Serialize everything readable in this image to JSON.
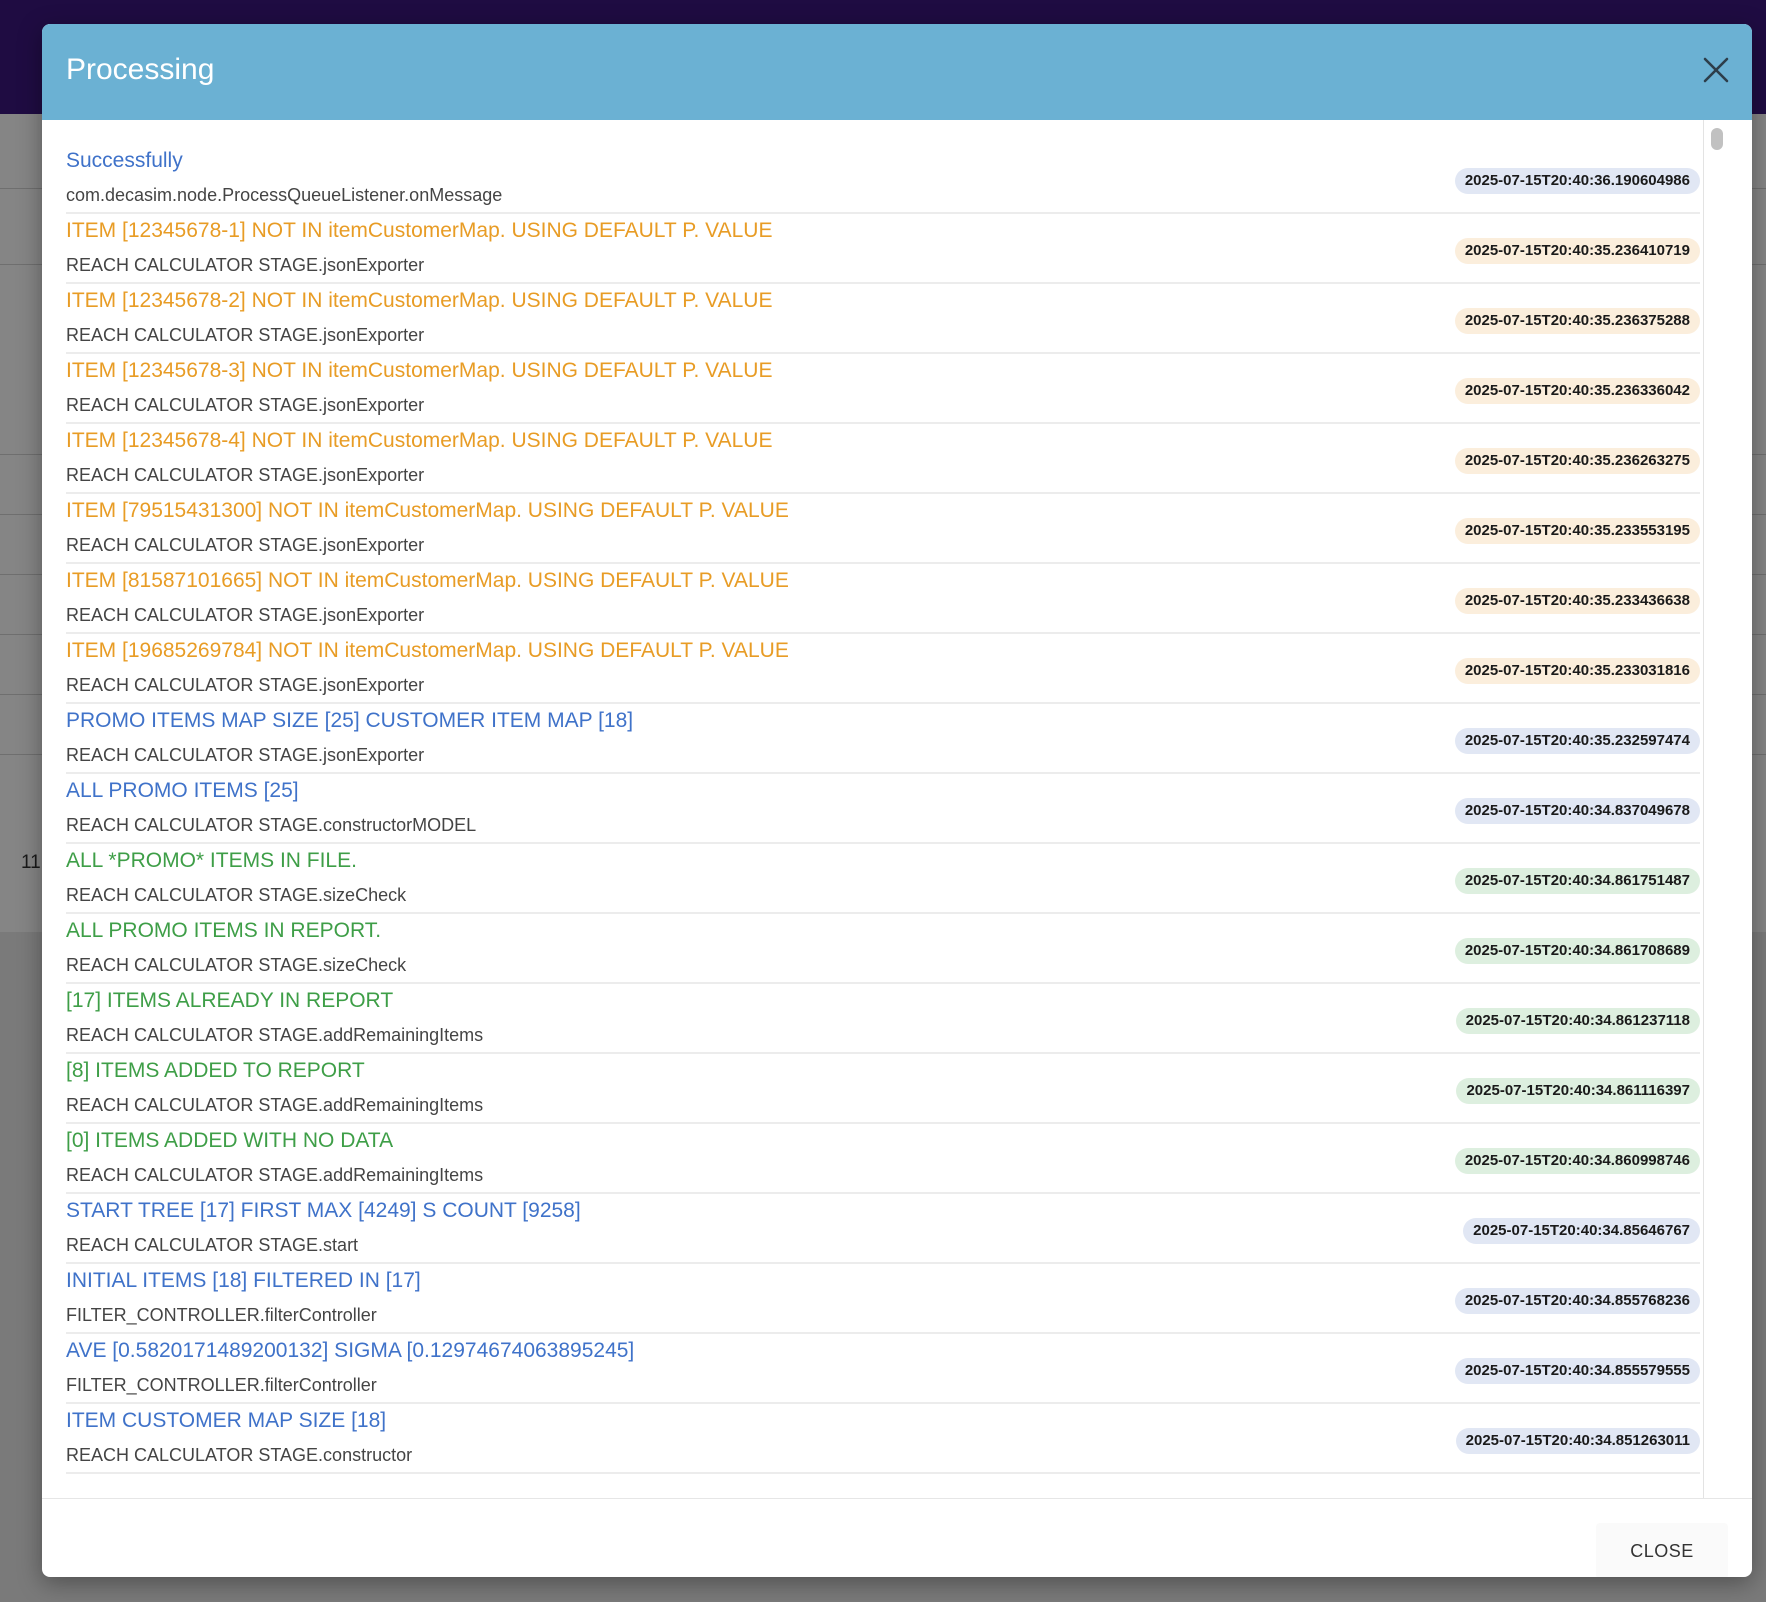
{
  "modal": {
    "title": "Processing",
    "close_label": "CLOSE"
  },
  "background": {
    "stub_text": "11"
  },
  "colors": {
    "header_bg": "#6bb1d3",
    "info": "#3f72c9",
    "warning": "#e89c25",
    "success": "#3e9e47",
    "badge_info": "#e1e7f4",
    "badge_warning": "#fbeedc",
    "badge_success": "#ddefdf"
  },
  "logs": [
    {
      "message": "Successfully",
      "source": "com.decasim.node.ProcessQueueListener.onMessage",
      "timestamp": "2025-07-15T20:40:36.190604986",
      "level": "info"
    },
    {
      "message": "ITEM [12345678-1] NOT IN itemCustomerMap. USING DEFAULT P. VALUE",
      "source": "REACH CALCULATOR STAGE.jsonExporter",
      "timestamp": "2025-07-15T20:40:35.236410719",
      "level": "warning"
    },
    {
      "message": "ITEM [12345678-2] NOT IN itemCustomerMap. USING DEFAULT P. VALUE",
      "source": "REACH CALCULATOR STAGE.jsonExporter",
      "timestamp": "2025-07-15T20:40:35.236375288",
      "level": "warning"
    },
    {
      "message": "ITEM [12345678-3] NOT IN itemCustomerMap. USING DEFAULT P. VALUE",
      "source": "REACH CALCULATOR STAGE.jsonExporter",
      "timestamp": "2025-07-15T20:40:35.236336042",
      "level": "warning"
    },
    {
      "message": "ITEM [12345678-4] NOT IN itemCustomerMap. USING DEFAULT P. VALUE",
      "source": "REACH CALCULATOR STAGE.jsonExporter",
      "timestamp": "2025-07-15T20:40:35.236263275",
      "level": "warning"
    },
    {
      "message": "ITEM [79515431300] NOT IN itemCustomerMap. USING DEFAULT P. VALUE",
      "source": "REACH CALCULATOR STAGE.jsonExporter",
      "timestamp": "2025-07-15T20:40:35.233553195",
      "level": "warning"
    },
    {
      "message": "ITEM [81587101665] NOT IN itemCustomerMap. USING DEFAULT P. VALUE",
      "source": "REACH CALCULATOR STAGE.jsonExporter",
      "timestamp": "2025-07-15T20:40:35.233436638",
      "level": "warning"
    },
    {
      "message": "ITEM [19685269784] NOT IN itemCustomerMap. USING DEFAULT P. VALUE",
      "source": "REACH CALCULATOR STAGE.jsonExporter",
      "timestamp": "2025-07-15T20:40:35.233031816",
      "level": "warning"
    },
    {
      "message": "PROMO ITEMS MAP SIZE [25] CUSTOMER ITEM MAP [18]",
      "source": "REACH CALCULATOR STAGE.jsonExporter",
      "timestamp": "2025-07-15T20:40:35.232597474",
      "level": "info"
    },
    {
      "message": "ALL PROMO ITEMS [25]",
      "source": "REACH CALCULATOR STAGE.constructorMODEL",
      "timestamp": "2025-07-15T20:40:34.837049678",
      "level": "info"
    },
    {
      "message": "ALL *PROMO* ITEMS IN FILE.",
      "source": "REACH CALCULATOR STAGE.sizeCheck",
      "timestamp": "2025-07-15T20:40:34.861751487",
      "level": "success"
    },
    {
      "message": "ALL PROMO ITEMS IN REPORT.",
      "source": "REACH CALCULATOR STAGE.sizeCheck",
      "timestamp": "2025-07-15T20:40:34.861708689",
      "level": "success"
    },
    {
      "message": "[17] ITEMS ALREADY IN REPORT",
      "source": "REACH CALCULATOR STAGE.addRemainingItems",
      "timestamp": "2025-07-15T20:40:34.861237118",
      "level": "success"
    },
    {
      "message": "[8] ITEMS ADDED TO REPORT",
      "source": "REACH CALCULATOR STAGE.addRemainingItems",
      "timestamp": "2025-07-15T20:40:34.861116397",
      "level": "success"
    },
    {
      "message": "[0] ITEMS ADDED WITH NO DATA",
      "source": "REACH CALCULATOR STAGE.addRemainingItems",
      "timestamp": "2025-07-15T20:40:34.860998746",
      "level": "success"
    },
    {
      "message": "START TREE [17] FIRST MAX [4249] S COUNT [9258]",
      "source": "REACH CALCULATOR STAGE.start",
      "timestamp": "2025-07-15T20:40:34.85646767",
      "level": "info"
    },
    {
      "message": "INITIAL ITEMS [18] FILTERED IN [17]",
      "source": "FILTER_CONTROLLER.filterController",
      "timestamp": "2025-07-15T20:40:34.855768236",
      "level": "info"
    },
    {
      "message": "AVE [0.5820171489200132] SIGMA [0.12974674063895245]",
      "source": "FILTER_CONTROLLER.filterController",
      "timestamp": "2025-07-15T20:40:34.855579555",
      "level": "info"
    },
    {
      "message": "ITEM CUSTOMER MAP SIZE [18]",
      "source": "REACH CALCULATOR STAGE.constructor",
      "timestamp": "2025-07-15T20:40:34.851263011",
      "level": "info"
    }
  ]
}
